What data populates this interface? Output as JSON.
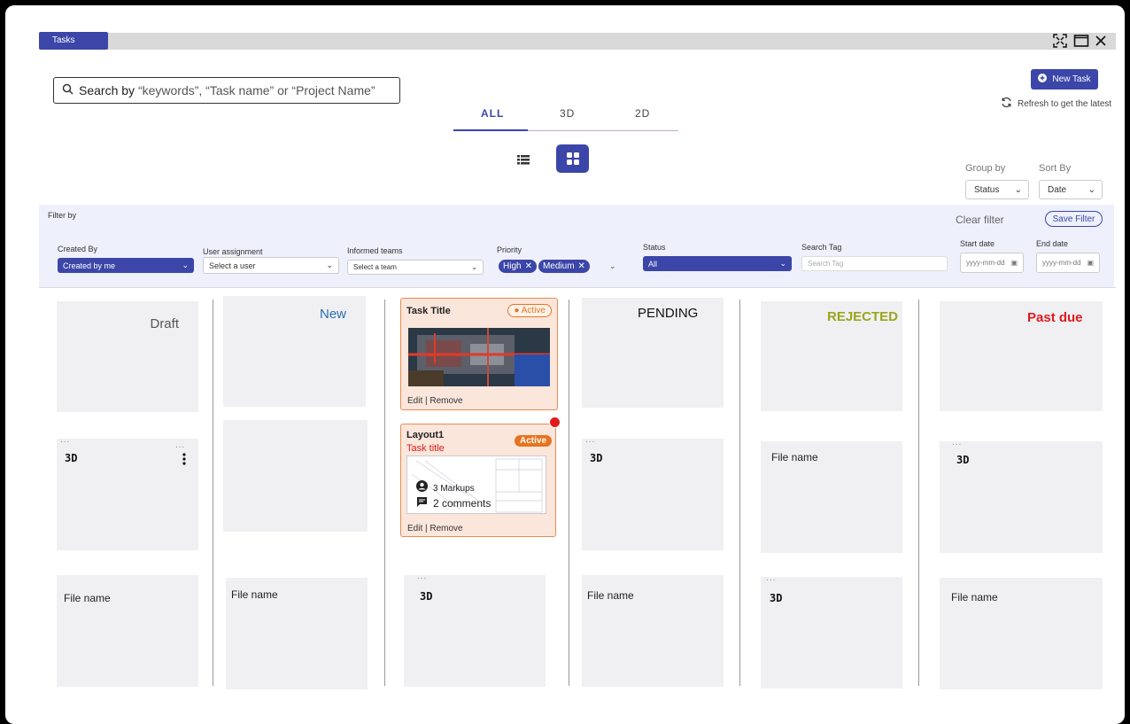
{
  "window": {
    "tab_label": "Tasks"
  },
  "search": {
    "prefix": "Search by ",
    "text": "“keywords”, “Task name” or “Project Name”"
  },
  "actions": {
    "new_task": "New Task",
    "refresh": "Refresh to get the latest"
  },
  "view_tabs": [
    "ALL",
    "3D",
    "2D"
  ],
  "grouping": {
    "group_by_label": "Group by",
    "group_by_value": "Status",
    "sort_by_label": "Sort By",
    "sort_by_value": "Date"
  },
  "filter": {
    "title": "Filter by",
    "clear": "Clear filter",
    "save": "Save Filter",
    "created_by": {
      "label": "Created By",
      "value": "Created by me"
    },
    "user_assignment": {
      "label": "User assignment",
      "placeholder": "Select a user"
    },
    "informed_teams": {
      "label": "Informed teams",
      "placeholder": "Select a team"
    },
    "priority": {
      "label": "Priority",
      "chips": [
        "High",
        "Medium"
      ]
    },
    "status": {
      "label": "Status",
      "value": "All"
    },
    "search_tag": {
      "label": "Search Tag",
      "placeholder": "Search Tag"
    },
    "start_date": {
      "label": "Start date",
      "placeholder": "yyyy-mm-dd"
    },
    "end_date": {
      "label": "End date",
      "placeholder": "yyyy-mm-dd"
    }
  },
  "columns": [
    {
      "title": "Draft",
      "color": "#555555"
    },
    {
      "title": "New",
      "color": "#2a6fb0"
    },
    {
      "title": "PENDING",
      "color": "#111111"
    },
    {
      "title": "REJECTED",
      "color": "#9aa619"
    },
    {
      "title": "Past due",
      "color": "#e01b1b"
    }
  ],
  "card_labels": {
    "three_d": "3D",
    "file_name": "File name",
    "dots": "..."
  },
  "task_cards": [
    {
      "title": "Task Title",
      "badge": "Active",
      "actions": "Edit | Remove"
    },
    {
      "title": "Layout1",
      "subtitle": "Task title",
      "badge": "Active",
      "markups": "3 Markups",
      "comments": "2 comments",
      "actions": "Edit | Remove"
    }
  ],
  "colors": {
    "accent": "#3b46a8",
    "active_badge": "#e8731f",
    "alert_dot": "#e01b1b"
  }
}
